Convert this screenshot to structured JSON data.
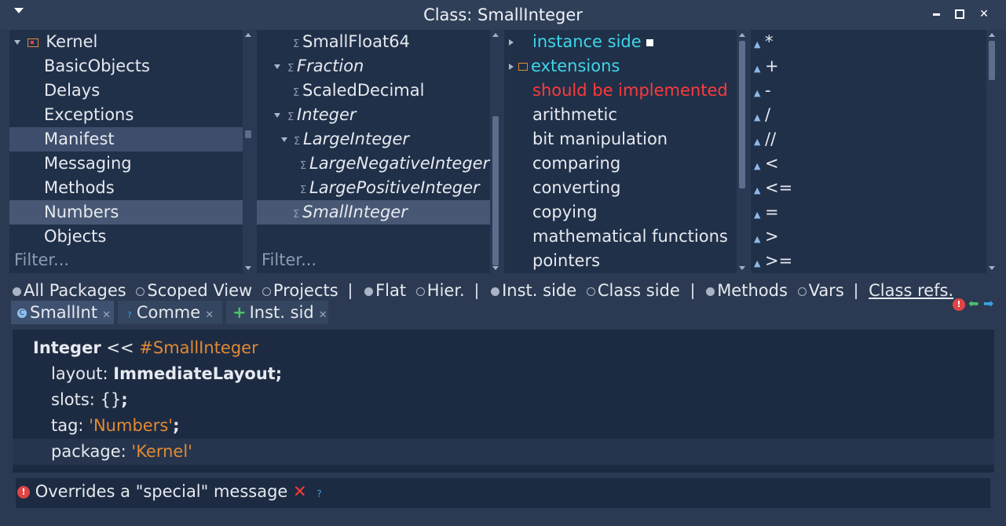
{
  "window": {
    "title": "Class: SmallInteger",
    "minimize_label": "▬",
    "maximize_label": "■",
    "close_label": "✕"
  },
  "packages": {
    "items": [
      "Kernel",
      "BasicObjects",
      "Delays",
      "Exceptions",
      "Manifest",
      "Messaging",
      "Methods",
      "Numbers",
      "Objects"
    ],
    "filter_placeholder": "Filter..."
  },
  "classes": {
    "items": [
      "SmallFloat64",
      "Fraction",
      "ScaledDecimal",
      "Integer",
      "LargeInteger",
      "LargeNegativeInteger",
      "LargePositiveInteger",
      "SmallInteger"
    ],
    "filter_placeholder": "Filter..."
  },
  "protocols": {
    "items": [
      "instance side",
      "extensions",
      "should be implemented",
      "arithmetic",
      "bit manipulation",
      "comparing",
      "converting",
      "copying",
      "mathematical functions",
      "pointers"
    ]
  },
  "methods": {
    "items": [
      "*",
      "+",
      "-",
      "/",
      "//",
      "<",
      "<=",
      "=",
      ">",
      ">="
    ]
  },
  "options": {
    "all_packages": "All Packages",
    "scoped_view": "Scoped View",
    "projects": "Projects",
    "flat": "Flat",
    "hier": "Hier.",
    "inst_side": "Inst. side",
    "class_side": "Class side",
    "methods": "Methods",
    "vars": "Vars",
    "class_refs": "Class refs."
  },
  "tabs": [
    {
      "label": "SmallInt",
      "icon": "C"
    },
    {
      "label": "Comme",
      "icon": "?"
    },
    {
      "label": "Inst. sid",
      "icon": "+"
    }
  ],
  "code": {
    "superclass": "Integer",
    "op": "<<",
    "symbol": "#SmallInteger",
    "layout_kw": "layout:",
    "layout_val": "ImmediateLayout;",
    "slots_kw": "slots:",
    "slots_val": "{}",
    "slots_semi": ";",
    "tag_kw": "tag:",
    "tag_val": "'Numbers'",
    "tag_semi": ";",
    "package_kw": "package:",
    "package_val": "'Kernel'"
  },
  "status": {
    "message": "Overrides a \"special\" message",
    "dismiss": "✕",
    "help": "?"
  },
  "colors": {
    "cyan": "#3fd5e8",
    "red": "#ff3a3a",
    "orange": "#e08a35",
    "green": "#4bc06a",
    "blue": "#3aa0e0"
  }
}
